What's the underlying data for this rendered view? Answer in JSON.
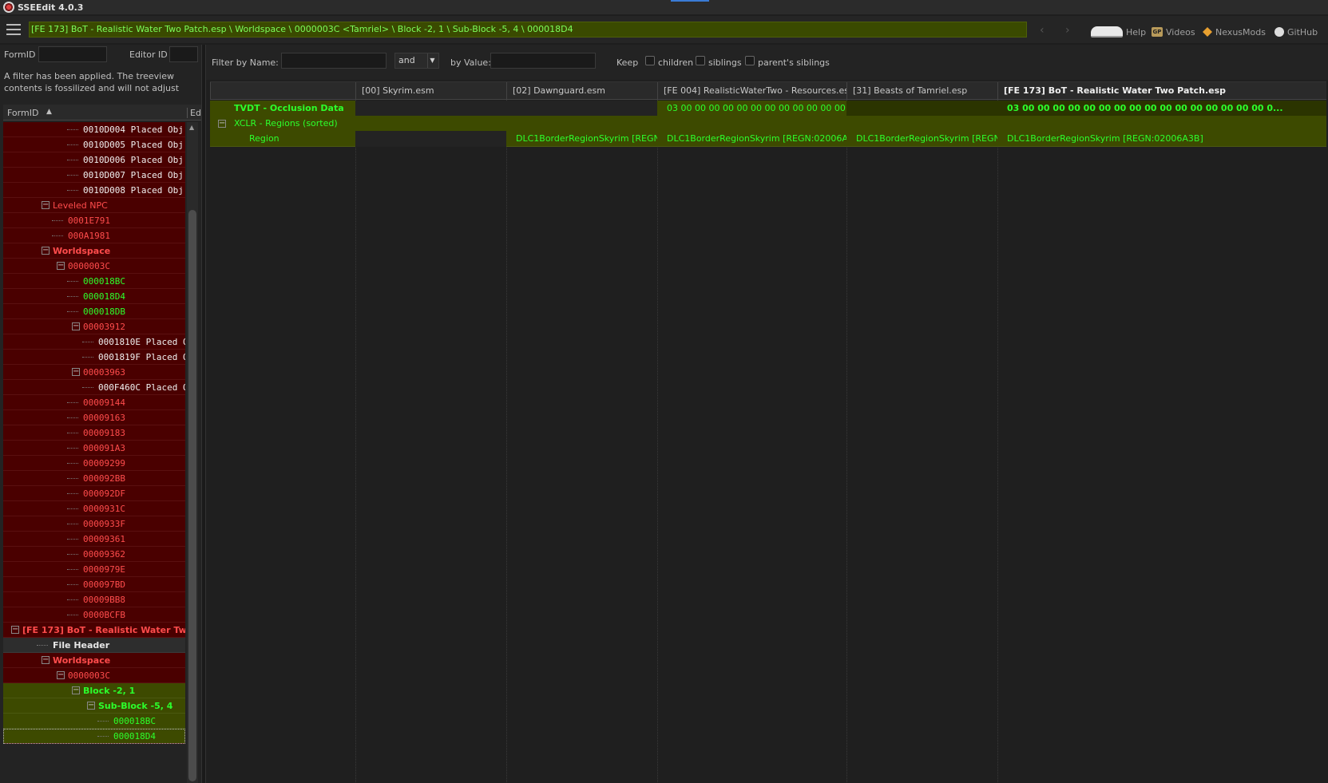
{
  "window": {
    "title": "SSEEdit 4.0.3"
  },
  "pathbar": {
    "text": "[FE 173] BoT - Realistic Water Two Patch.esp \\ Worldspace \\ 0000003C <Tamriel> \\ Block -2, 1 \\ Sub-Block -5, 4 \\ 000018D4"
  },
  "nav": {
    "back": "‹",
    "forward": "›"
  },
  "links": {
    "help": "Help",
    "videos": "Videos",
    "nexusmods": "NexusMods",
    "github": "GitHub",
    "videos_icon": "GP"
  },
  "left": {
    "formid_label": "FormID",
    "editorid_label": "Editor ID",
    "filter_note": "A filter has been applied. The treeview contents is fossilized and will not adjust",
    "tree_col1": "FormID",
    "tree_col2": "Ed",
    "tree_rows": [
      {
        "text": "0010D004  Placed Obj",
        "color": "white",
        "mono": true,
        "depth": 4
      },
      {
        "text": "0010D005  Placed Obj",
        "color": "white",
        "mono": true,
        "depth": 4
      },
      {
        "text": "0010D006  Placed Obj",
        "color": "white",
        "mono": true,
        "depth": 4
      },
      {
        "text": "0010D007  Placed Obj",
        "color": "white",
        "mono": true,
        "depth": 4
      },
      {
        "text": "0010D008  Placed Obj",
        "color": "white",
        "mono": true,
        "depth": 4
      },
      {
        "text": "Leveled NPC",
        "color": "red",
        "depth": 2,
        "expander": "−"
      },
      {
        "text": "0001E791",
        "color": "red",
        "mono": true,
        "depth": 3
      },
      {
        "text": "000A1981",
        "color": "red",
        "mono": true,
        "depth": 3
      },
      {
        "text": "Worldspace",
        "color": "red",
        "bold": true,
        "depth": 2,
        "expander": "−"
      },
      {
        "text": "0000003C",
        "color": "red",
        "mono": true,
        "depth": 3,
        "expander": "−"
      },
      {
        "text": "000018BC",
        "color": "green",
        "mono": true,
        "depth": 4
      },
      {
        "text": "000018D4",
        "color": "green",
        "mono": true,
        "depth": 4
      },
      {
        "text": "000018DB",
        "color": "green",
        "mono": true,
        "depth": 4
      },
      {
        "text": "00003912",
        "color": "red",
        "mono": true,
        "depth": 4,
        "expander": "−"
      },
      {
        "text": "0001810E  Placed O",
        "color": "white",
        "mono": true,
        "depth": 5
      },
      {
        "text": "0001819F  Placed O",
        "color": "white",
        "mono": true,
        "depth": 5
      },
      {
        "text": "00003963",
        "color": "red",
        "mono": true,
        "depth": 4,
        "expander": "−"
      },
      {
        "text": "000F460C  Placed O",
        "color": "white",
        "mono": true,
        "depth": 5
      },
      {
        "text": "00009144",
        "color": "red",
        "mono": true,
        "depth": 4
      },
      {
        "text": "00009163",
        "color": "red",
        "mono": true,
        "depth": 4
      },
      {
        "text": "00009183",
        "color": "red",
        "mono": true,
        "depth": 4
      },
      {
        "text": "000091A3",
        "color": "red",
        "mono": true,
        "depth": 4
      },
      {
        "text": "00009299",
        "color": "red",
        "mono": true,
        "depth": 4
      },
      {
        "text": "000092BB",
        "color": "red",
        "mono": true,
        "depth": 4
      },
      {
        "text": "000092DF",
        "color": "red",
        "mono": true,
        "depth": 4
      },
      {
        "text": "0000931C",
        "color": "red",
        "mono": true,
        "depth": 4
      },
      {
        "text": "0000933F",
        "color": "red",
        "mono": true,
        "depth": 4
      },
      {
        "text": "00009361",
        "color": "red",
        "mono": true,
        "depth": 4
      },
      {
        "text": "00009362",
        "color": "red",
        "mono": true,
        "depth": 4
      },
      {
        "text": "0000979E",
        "color": "red",
        "mono": true,
        "depth": 4
      },
      {
        "text": "000097BD",
        "color": "red",
        "mono": true,
        "depth": 4
      },
      {
        "text": "00009BB8",
        "color": "red",
        "mono": true,
        "depth": 4
      },
      {
        "text": "0000BCFB",
        "color": "red",
        "mono": true,
        "depth": 4
      },
      {
        "text": "[FE 173] BoT - Realistic Water Tw...",
        "color": "red",
        "bold": true,
        "depth": 0,
        "expander": "−"
      },
      {
        "text": "File Header",
        "color": "grey",
        "bold": true,
        "depth": 2,
        "bg": "plain"
      },
      {
        "text": "Worldspace",
        "color": "red",
        "bold": true,
        "depth": 2,
        "expander": "−"
      },
      {
        "text": "0000003C",
        "color": "red",
        "mono": true,
        "depth": 3,
        "expander": "−"
      },
      {
        "text": "Block -2, 1",
        "color": "green",
        "bold": true,
        "depth": 4,
        "expander": "−",
        "bg": "olive"
      },
      {
        "text": "Sub-Block -5, 4",
        "color": "green",
        "bold": true,
        "depth": 5,
        "expander": "−",
        "bg": "olive"
      },
      {
        "text": "000018BC",
        "color": "green",
        "mono": true,
        "depth": 6,
        "bg": "olive"
      },
      {
        "text": "000018D4",
        "color": "green",
        "mono": true,
        "depth": 6,
        "bg": "sel"
      }
    ]
  },
  "filterbar": {
    "by_name": "Filter by Name:",
    "and_value": "and",
    "by_value": "by Value:",
    "keep": "Keep",
    "children": "children",
    "siblings": "siblings",
    "parents_siblings": "parent's siblings"
  },
  "grid": {
    "columns": [
      "",
      "[00] Skyrim.esm",
      "[02] Dawnguard.esm",
      "[FE 004] RealisticWaterTwo - Resources.esm",
      "[31] Beasts of Tamriel.esp",
      "[FE 173] BoT - Realistic Water Two Patch.esp"
    ],
    "rows": [
      {
        "name": "TVDT - Occlusion Data",
        "cells": [
          "",
          "",
          "03 00 00 00 00 00 00 00 00 00 00 00 00 00 00 ...",
          "",
          "03 00 00 00 00 00 00 00 00 00 00 00 00 00 00 00 00 0..."
        ]
      },
      {
        "name": "XCLR - Regions (sorted)",
        "cells": [
          "",
          "",
          "",
          "",
          ""
        ]
      },
      {
        "name": "Region",
        "cells": [
          "",
          "DLC1BorderRegionSkyrim [REGN...",
          "DLC1BorderRegionSkyrim [REGN:02006A3B]",
          "DLC1BorderRegionSkyrim [REGN...",
          "DLC1BorderRegionSkyrim [REGN:02006A3B]"
        ]
      }
    ]
  },
  "colors": {
    "red": "#ff4c4c",
    "green": "#2cff2c",
    "white": "#f0f0f0",
    "olive": "#3d4a00"
  }
}
